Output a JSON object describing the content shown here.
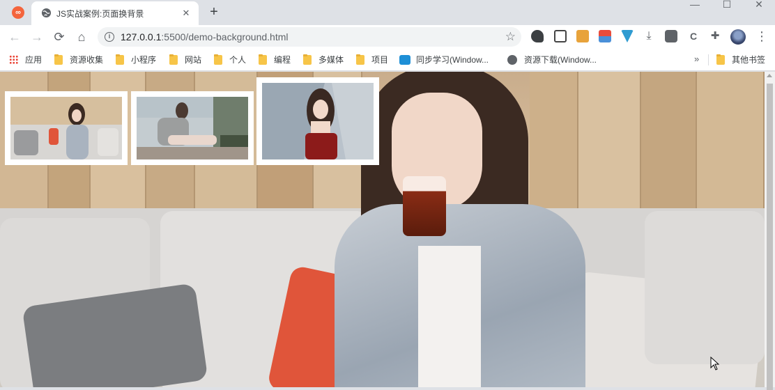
{
  "browser": {
    "tab": {
      "title": "JS实战案例:页面换背景"
    },
    "omnibox": {
      "host": "127.0.0.1",
      "path": ":5500/demo-background.html"
    }
  },
  "bookmarks": [
    {
      "label": "应用",
      "icon": "apps-icon"
    },
    {
      "label": "资源收集",
      "icon": "folder-icon"
    },
    {
      "label": "小程序",
      "icon": "folder-icon"
    },
    {
      "label": "网站",
      "icon": "folder-icon"
    },
    {
      "label": "个人",
      "icon": "folder-icon"
    },
    {
      "label": "编程",
      "icon": "folder-icon"
    },
    {
      "label": "多媒体",
      "icon": "folder-icon"
    },
    {
      "label": "项目",
      "icon": "folder-icon"
    },
    {
      "label": "同步学习(Window...",
      "icon": "cloud-icon"
    },
    {
      "label": "资源下载(Window...",
      "icon": "globe-icon"
    },
    {
      "label": "其他书签",
      "icon": "folder-icon"
    }
  ],
  "thumbnails": [
    {
      "name": "thumbnail-1",
      "depicts": "woman-sitting-on-sofa-drinking"
    },
    {
      "name": "thumbnail-2",
      "depicts": "woman-sitting-on-terrace"
    },
    {
      "name": "thumbnail-3",
      "depicts": "woman-in-red-top-outdoors"
    }
  ],
  "colors": {
    "tabstrip": "#dee1e6",
    "thumb_border": "#ffffff",
    "profile_badge": "#f4643c"
  }
}
